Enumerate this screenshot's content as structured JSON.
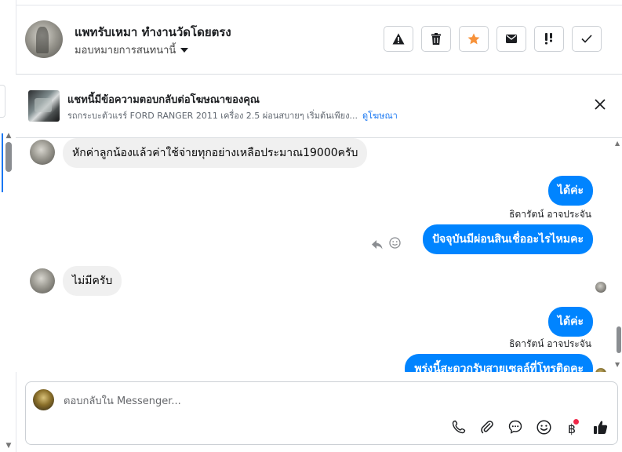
{
  "header": {
    "contact_name": "แพทรับเหมา ทำงานวัดโดยตรง",
    "assign_label": "มอบหมายการสนทนานี้",
    "toolbar": [
      {
        "name": "spam",
        "icon": "warning-icon",
        "color": "#1c1e21"
      },
      {
        "name": "delete",
        "icon": "trash-icon",
        "color": "#1c1e21"
      },
      {
        "name": "star",
        "icon": "star-icon",
        "color": "#f7923a"
      },
      {
        "name": "mark-unread",
        "icon": "envelope-icon",
        "color": "#1c1e21"
      },
      {
        "name": "follow-up",
        "icon": "exclamation-icon",
        "color": "#1c1e21"
      },
      {
        "name": "mark-done",
        "icon": "check-icon",
        "color": "#1c1e21"
      }
    ]
  },
  "ad": {
    "title": "แชทนี้มีข้อความตอบกลับต่อโฆษณาของคุณ",
    "description": "รถกระบะตัวแรร์ FORD RANGER 2011 เครื่อง 2.5 ผ่อนสบายๆ เริ่มต้นเพียง...",
    "link": "ดูโฆษณา"
  },
  "messages": [
    {
      "direction": "in",
      "text": "หักค่าลูกน้องแล้วค่าใช้จ่ายทุกอย่างเหลือประมาณ19000ครับ"
    },
    {
      "direction": "out",
      "text": "ได้ค่ะ"
    },
    {
      "direction": "out",
      "sender": "ธิดารัตน์ อาจประจัน",
      "text": "ปัจจุบันมีผ่อนสินเชื่ออะไรไหมคะ"
    },
    {
      "direction": "in",
      "text": "ไม่มีครับ"
    },
    {
      "direction": "out",
      "text": "ได้ค่ะ"
    },
    {
      "direction": "out",
      "sender": "ธิดารัตน์ อาจประจัน",
      "text": "พรุ่งนี้สะดวกรับสายเซลล์ที่โทรติดคะ"
    }
  ],
  "composer": {
    "placeholder": "ตอบกลับใน Messenger...",
    "icons": [
      "phone-icon",
      "attachment-icon",
      "saved-reply-icon",
      "emoji-icon",
      "baht-payment-icon",
      "like-icon"
    ]
  },
  "colors": {
    "brand_blue": "#1877f2",
    "bubble_out": "#0084ff",
    "bubble_in": "#f0f0f0",
    "star_orange": "#f7923a",
    "notification_red": "#f02849"
  }
}
